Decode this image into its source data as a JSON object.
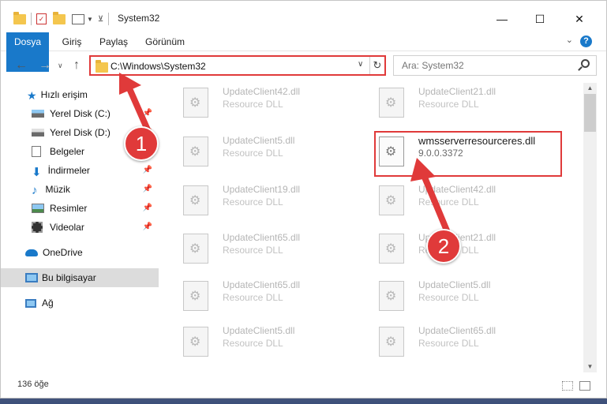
{
  "window": {
    "title": "System32"
  },
  "ribbon": {
    "tabs": [
      "Dosya",
      "Giriş",
      "Paylaş",
      "Görünüm"
    ]
  },
  "address": {
    "path": "C:\\Windows\\System32"
  },
  "search": {
    "placeholder": "Ara: System32"
  },
  "nav": {
    "items": [
      {
        "label": "Hızlı erişim"
      },
      {
        "label": "Yerel Disk (C:)"
      },
      {
        "label": "Yerel Disk (D:)"
      },
      {
        "label": "Belgeler"
      },
      {
        "label": "İndirmeler"
      },
      {
        "label": "Müzik"
      },
      {
        "label": "Resimler"
      },
      {
        "label": "Videolar"
      },
      {
        "label": "OneDrive"
      },
      {
        "label": "Bu bilgisayar"
      },
      {
        "label": "Ağ"
      }
    ]
  },
  "files": [
    {
      "name": "UpdateClient42.dll",
      "desc": "Resource DLL"
    },
    {
      "name": "UpdateClient21.dll",
      "desc": "Resource DLL"
    },
    {
      "name": "UpdateClient5.dll",
      "desc": "Resource DLL"
    },
    {
      "name": "wmsserverresourceres.dll",
      "desc": "9.0.0.3372"
    },
    {
      "name": "UpdateClient19.dll",
      "desc": "Resource DLL"
    },
    {
      "name": "UpdateClient42.dll",
      "desc": "Resource DLL"
    },
    {
      "name": "UpdateClient65.dll",
      "desc": "Resource DLL"
    },
    {
      "name": "UpdateClient21.dll",
      "desc": "Resource DLL"
    },
    {
      "name": "UpdateClient65.dll",
      "desc": "Resource DLL"
    },
    {
      "name": "UpdateClient5.dll",
      "desc": "Resource DLL"
    },
    {
      "name": "UpdateClient5.dll",
      "desc": "Resource DLL"
    },
    {
      "name": "UpdateClient65.dll",
      "desc": "Resource DLL"
    }
  ],
  "status": {
    "count": "136 öğe"
  },
  "annotations": {
    "step1": "1",
    "step2": "2"
  },
  "colors": {
    "accent": "#1979ca",
    "highlight": "#e03a3a"
  }
}
